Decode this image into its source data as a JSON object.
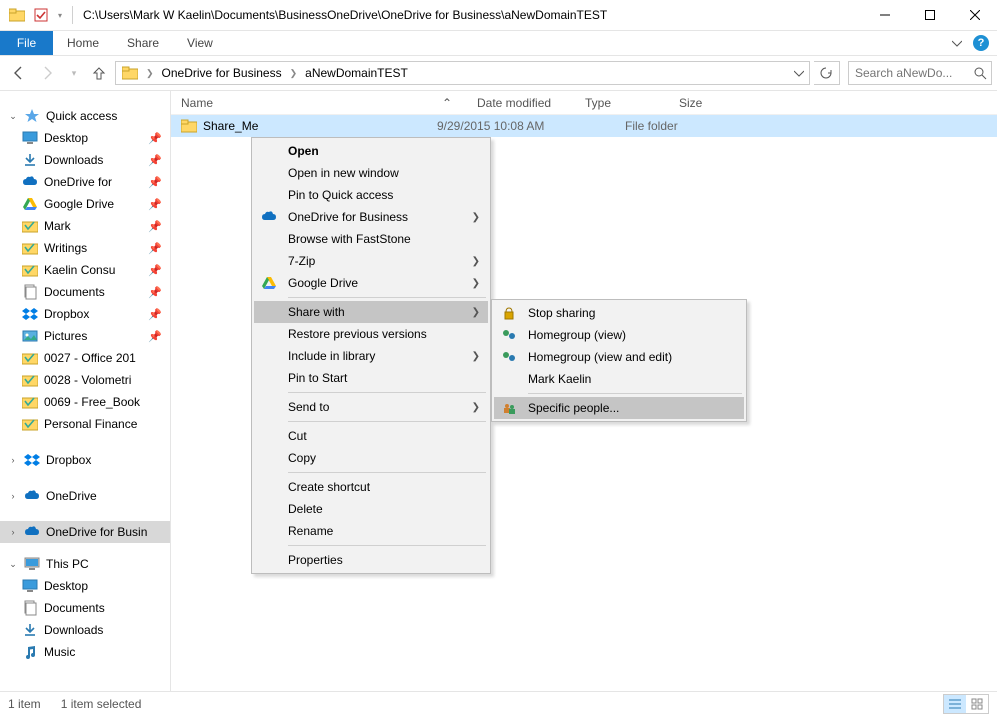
{
  "titlebar": {
    "path": "C:\\Users\\Mark W Kaelin\\Documents\\BusinessOneDrive\\OneDrive for Business\\aNewDomainTEST"
  },
  "ribbon": {
    "file": "File",
    "tabs": [
      "Home",
      "Share",
      "View"
    ]
  },
  "breadcrumb": {
    "segments": [
      "OneDrive for Business",
      "aNewDomainTEST"
    ]
  },
  "search": {
    "placeholder": "Search aNewDo..."
  },
  "columns": {
    "name": "Name",
    "date": "Date modified",
    "type": "Type",
    "size": "Size"
  },
  "files": [
    {
      "name": "Share_Me",
      "date": "9/29/2015 10:08 AM",
      "type": "File folder",
      "size": ""
    }
  ],
  "nav": {
    "quick_access": "Quick access",
    "quick_items": [
      "Desktop",
      "Downloads",
      "OneDrive for",
      "Google Drive",
      "Mark",
      "Writings",
      "Kaelin Consu",
      "Documents",
      "Dropbox",
      "Pictures",
      "0027 - Office 201",
      "0028 - Volometri",
      "0069 - Free_Book",
      "Personal Finance"
    ],
    "dropbox": "Dropbox",
    "onedrive": "OneDrive",
    "onedrive_business": "OneDrive for Busin",
    "this_pc": "This PC",
    "pc_items": [
      "Desktop",
      "Documents",
      "Downloads",
      "Music"
    ]
  },
  "context_menu": {
    "items_top": [
      "Open",
      "Open in new window",
      "Pin to Quick access"
    ],
    "onedrive_business": "OneDrive for Business",
    "browse_faststone": "Browse with FastStone",
    "seven_zip": "7-Zip",
    "google_drive": "Google Drive",
    "share_with": "Share with",
    "restore": "Restore previous versions",
    "include_library": "Include in library",
    "pin_start": "Pin to Start",
    "send_to": "Send to",
    "cut": "Cut",
    "copy": "Copy",
    "create_shortcut": "Create shortcut",
    "delete": "Delete",
    "rename": "Rename",
    "properties": "Properties"
  },
  "submenu": {
    "stop_sharing": "Stop sharing",
    "homegroup_view": "Homegroup (view)",
    "homegroup_edit": "Homegroup (view and edit)",
    "user": "Mark Kaelin",
    "specific": "Specific people..."
  },
  "status": {
    "count": "1 item",
    "selected": "1 item selected"
  }
}
